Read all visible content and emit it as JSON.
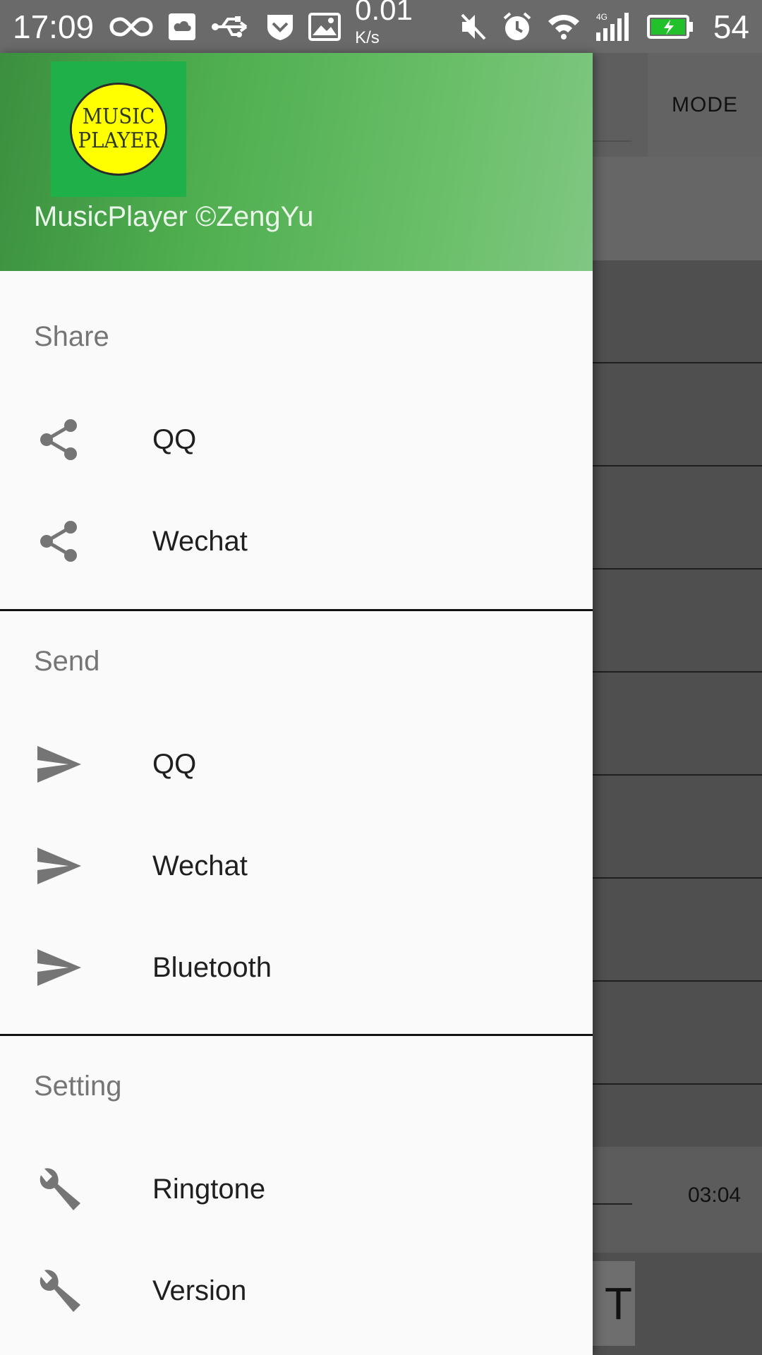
{
  "status_bar": {
    "time": "17:09",
    "network_speed": "0.01",
    "network_speed_unit": "K/s",
    "battery_level": "54",
    "icons": [
      "infinity-icon",
      "cloud-icon",
      "usb-icon",
      "shield-icon",
      "image-icon",
      "mute-icon",
      "alarm-icon",
      "wifi-icon",
      "signal-4g-icon",
      "battery-charging-icon"
    ]
  },
  "background_app": {
    "mode_button": "MODE",
    "duration": "03:04",
    "partial_button_text": "T"
  },
  "drawer": {
    "header_title": "MusicPlayer ©ZengYu",
    "logo_line1": "MUSIC",
    "logo_line2": "PLAYER",
    "sections": [
      {
        "title": "Share",
        "items": [
          {
            "label": "QQ",
            "icon": "share-icon"
          },
          {
            "label": "Wechat",
            "icon": "share-icon"
          }
        ]
      },
      {
        "title": "Send",
        "items": [
          {
            "label": "QQ",
            "icon": "send-icon"
          },
          {
            "label": "Wechat",
            "icon": "send-icon"
          },
          {
            "label": "Bluetooth",
            "icon": "send-icon"
          }
        ]
      },
      {
        "title": "Setting",
        "items": [
          {
            "label": "Ringtone",
            "icon": "wrench-icon"
          },
          {
            "label": "Version",
            "icon": "wrench-icon"
          }
        ]
      }
    ]
  },
  "colors": {
    "header_gradient_start": "#3b8f3f",
    "header_gradient_end": "#80c783",
    "logo_background": "#1fb04a",
    "logo_circle": "#ffff00",
    "icon_gray": "#757575",
    "drawer_background": "#fafafa"
  }
}
